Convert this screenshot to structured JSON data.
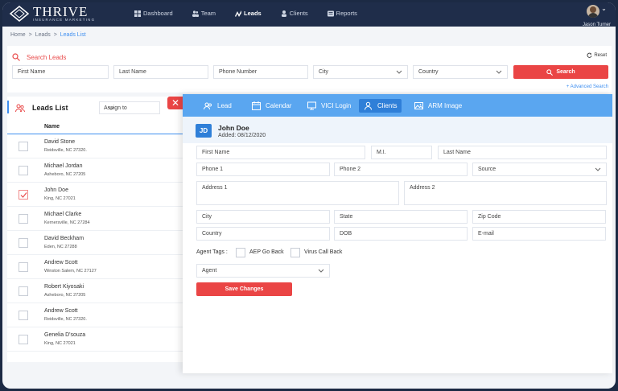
{
  "header": {
    "logo_title": "THRIVE",
    "logo_subtitle": "INSURANCE MARKETING",
    "nav": [
      {
        "label": "Dashboard",
        "icon": "dashboard-icon"
      },
      {
        "label": "Team",
        "icon": "team-icon"
      },
      {
        "label": "Leads",
        "icon": "leads-icon",
        "active": true
      },
      {
        "label": "Clients",
        "icon": "clients-icon"
      },
      {
        "label": "Reports",
        "icon": "reports-icon"
      }
    ],
    "user_name": "Jason Turner"
  },
  "breadcrumb": {
    "home": "Home",
    "leads": "Leads",
    "current": "Leads List",
    "separator": ">"
  },
  "search": {
    "title": "Search Leads",
    "reset_label": "Reset",
    "first_name_placeholder": "First Name",
    "last_name_placeholder": "Last Name",
    "phone_placeholder": "Phone Number",
    "city_placeholder": "City",
    "country_placeholder": "Country",
    "search_button": "Search",
    "advanced_label": "Advanced Search",
    "advanced_prefix": "+"
  },
  "leads": {
    "title": "Leads List",
    "assign_label": "Assign to",
    "close_label": "✕",
    "column_name": "Name",
    "rows": [
      {
        "name": "David Stone",
        "address": "Reidsville, NC 27320.",
        "checked": false
      },
      {
        "name": "Michael Jordan",
        "address": "Asheboro, NC 27205",
        "checked": false
      },
      {
        "name": "John Doe",
        "address": "King, NC 27021",
        "checked": true
      },
      {
        "name": "Michael Clarke",
        "address": "Kernersville, NC 27284",
        "checked": false
      },
      {
        "name": "David Beckham",
        "address": "Eden, NC 27288",
        "checked": false
      },
      {
        "name": "Andrew Scott",
        "address": "Winston Salem, NC 27127",
        "checked": false
      },
      {
        "name": "Robert Kiyosaki",
        "address": "Asheboro, NC 27205",
        "checked": false
      },
      {
        "name": "Andrew Scott",
        "address": "Reidsville, NC 27320.",
        "checked": false
      },
      {
        "name": "Genelia D'souza",
        "address": "King, NC 27021",
        "checked": false
      }
    ]
  },
  "detail": {
    "tabs": [
      {
        "label": "Lead",
        "icon": "lead-icon"
      },
      {
        "label": "Calendar",
        "icon": "calendar-icon"
      },
      {
        "label": "VICI Login",
        "icon": "vici-login-icon"
      },
      {
        "label": "Clients",
        "icon": "clients-icon",
        "active": true
      },
      {
        "label": "ARM Image",
        "icon": "arm-image-icon"
      }
    ],
    "initials": "JD",
    "name": "John Doe",
    "added": "Added: 08/12/2020",
    "fields": {
      "first_name": "First Name",
      "mi": "M.I.",
      "last_name": "Last Name",
      "phone1": "Phone 1",
      "phone2": "Phone 2",
      "source": "Source",
      "address1": "Address 1",
      "address2": "Address 2",
      "city": "City",
      "state": "State",
      "zip": "Zip Code",
      "country": "Country",
      "dob": "DOB",
      "email": "E-mail",
      "agent": "Agent"
    },
    "agent_tags_label": "Agent Tags :",
    "tags": [
      "AEP Go Back",
      "Virus Call Back"
    ],
    "save_button": "Save Changes"
  },
  "colors": {
    "accent": "#ea4545",
    "primary": "#2f7fd8",
    "tab_bar": "#5aa6f0",
    "nav_bg": "#1f2d4a"
  }
}
